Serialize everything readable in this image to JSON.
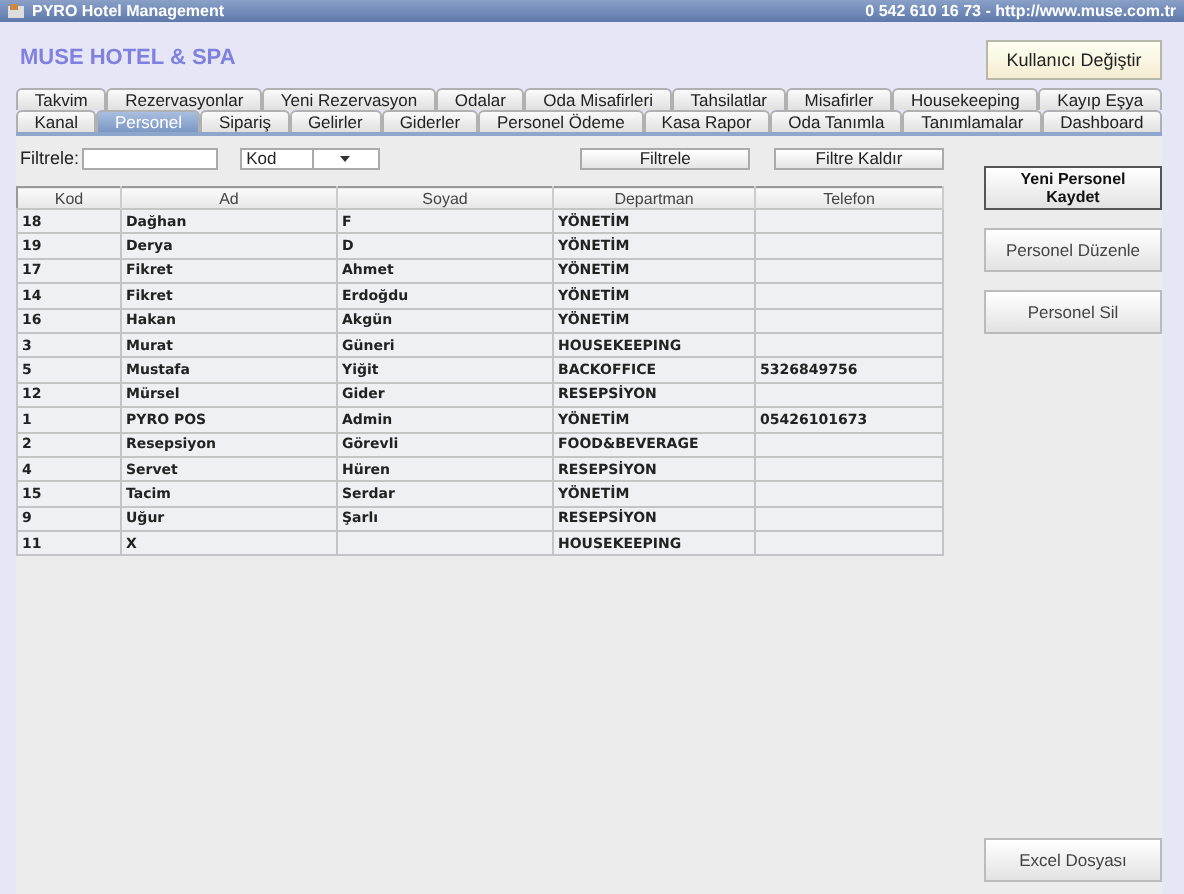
{
  "window": {
    "title": "PYRO Hotel Management",
    "contact": "0 542 610 16 73  -  http://www.muse.com.tr"
  },
  "brand": "MUSE HOTEL & SPA",
  "user_button": "Kullanıcı Değiştir",
  "tab_rows": [
    [
      {
        "label": "Takvim",
        "selected": false
      },
      {
        "label": "Rezervasyonlar",
        "selected": false
      },
      {
        "label": "Yeni Rezervasyon",
        "selected": false
      },
      {
        "label": "Odalar",
        "selected": false
      },
      {
        "label": "Oda Misafirleri",
        "selected": false
      },
      {
        "label": "Tahsilatlar",
        "selected": false
      },
      {
        "label": "Misafirler",
        "selected": false
      },
      {
        "label": "Housekeeping",
        "selected": false
      },
      {
        "label": "Kayıp Eşya",
        "selected": false
      }
    ],
    [
      {
        "label": "Kanal",
        "selected": false
      },
      {
        "label": "Personel",
        "selected": true
      },
      {
        "label": "Sipariş",
        "selected": false
      },
      {
        "label": "Gelirler",
        "selected": false
      },
      {
        "label": "Giderler",
        "selected": false
      },
      {
        "label": "Personel Ödeme",
        "selected": false
      },
      {
        "label": "Kasa Rapor",
        "selected": false
      },
      {
        "label": "Oda Tanımla",
        "selected": false
      },
      {
        "label": "Tanımlamalar",
        "selected": false
      },
      {
        "label": "Dashboard",
        "selected": false
      }
    ]
  ],
  "filter": {
    "label": "Filtrele:",
    "field_value": "Kod",
    "filter_button": "Filtrele",
    "clear_button": "Filtre Kaldır"
  },
  "table": {
    "columns": [
      "Kod",
      "Ad",
      "Soyad",
      "Departman",
      "Telefon"
    ],
    "rows": [
      [
        "18",
        "Dağhan",
        "F",
        "YÖNETİM",
        ""
      ],
      [
        "19",
        "Derya",
        "D",
        "YÖNETİM",
        ""
      ],
      [
        "17",
        "Fikret",
        "Ahmet",
        "YÖNETİM",
        ""
      ],
      [
        "14",
        "Fikret",
        "Erdoğdu",
        "YÖNETİM",
        ""
      ],
      [
        "16",
        "Hakan",
        "Akgün",
        "YÖNETİM",
        ""
      ],
      [
        "3",
        "Murat",
        "Güneri",
        "HOUSEKEEPING",
        ""
      ],
      [
        "5",
        "Mustafa",
        "Yiğit",
        "BACKOFFICE",
        "5326849756"
      ],
      [
        "12",
        "Mürsel",
        "Gider",
        "RESEPSİYON",
        ""
      ],
      [
        "1",
        "PYRO POS",
        "Admin",
        "YÖNETİM",
        "05426101673"
      ],
      [
        "2",
        "Resepsiyon",
        "Görevli",
        "FOOD&BEVERAGE",
        ""
      ],
      [
        "4",
        "Servet",
        "Hüren",
        "RESEPSİYON",
        ""
      ],
      [
        "15",
        "Tacim",
        "Serdar",
        "YÖNETİM",
        ""
      ],
      [
        "9",
        "Uğur",
        "Şarlı",
        "RESEPSİYON",
        ""
      ],
      [
        "11",
        "X",
        "",
        "HOUSEKEEPING",
        ""
      ]
    ]
  },
  "actions": [
    {
      "label": "Yeni Personel Kaydet",
      "kind": "primary"
    },
    {
      "label": "Personel Düzenle",
      "kind": "normal"
    },
    {
      "label": "Personel Sil",
      "kind": "normal"
    }
  ],
  "export_button": "Excel Dosyası"
}
